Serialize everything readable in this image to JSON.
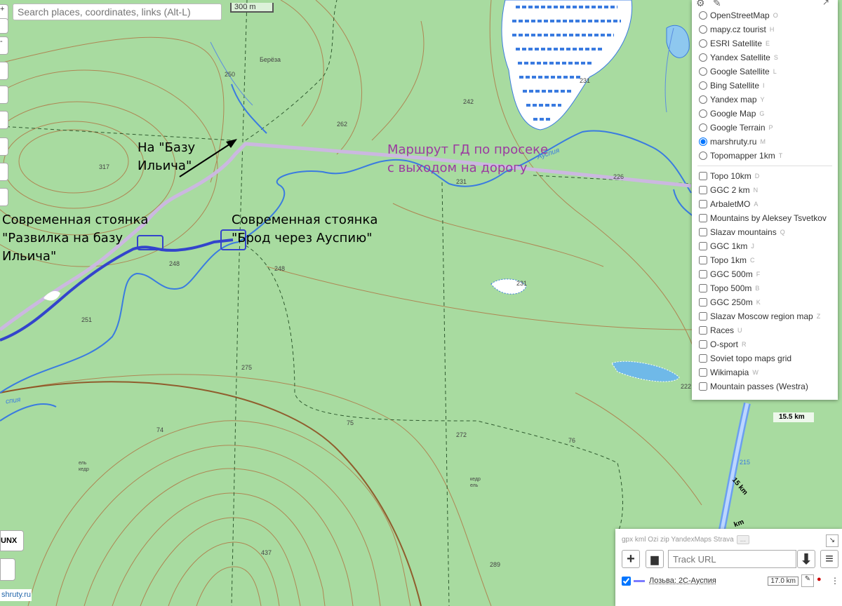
{
  "search": {
    "placeholder": "Search places, coordinates, links (Alt-L)"
  },
  "scale": {
    "label": "300 m"
  },
  "left_toolbar": {
    "unx_label": "UNX",
    "domain_label": "shruty.ru"
  },
  "annotations": {
    "to_base": "На \"Базу\nИльича\"",
    "camp_fork": "Современная стоянка\n\"Развилка на базу\nИльича\"",
    "camp_ford": "Современная стоянка\n\"Брод через Ауспию\"",
    "route": "Маршрут ГД по просеке\nс выходом на дорогу"
  },
  "map_labels": {
    "elev_317": "317",
    "elev_262": "262",
    "elev_242": "242",
    "elev_231a": "231",
    "elev_231b": "231",
    "elev_231c": "231",
    "elev_226": "226",
    "elev_250": "250",
    "elev_248a": "248",
    "elev_248b": "248",
    "elev_251": "251",
    "elev_275": "275",
    "elev_272": "272",
    "elev_289": "289",
    "elev_437": "437",
    "elev_74": "74",
    "elev_75": "75",
    "elev_76": "76",
    "elev_222": "222",
    "elev_215": "215",
    "river_auspiya": "Ауспия",
    "river_pia": "спия",
    "birch": "Берёза",
    "spruce_cedar": "ель\nкедр",
    "cedar_spruce": "кедр\nель",
    "km_15_5": "15.5 km",
    "km_15": "15 km",
    "km_14": "km"
  },
  "colors": {
    "map_green": "#a8dba0",
    "track_blue": "#3344cc",
    "route_purple": "#cbb8e0",
    "annotation_purple": "#9b3aa0",
    "river_blue": "#3a7be0",
    "contour_brown": "#a0522d"
  },
  "layers": {
    "base": [
      {
        "label": "OpenStreetMap",
        "key": "O",
        "checked": false
      },
      {
        "label": "mapy.cz tourist",
        "key": "H",
        "checked": false
      },
      {
        "label": "ESRI Satellite",
        "key": "E",
        "checked": false
      },
      {
        "label": "Yandex Satellite",
        "key": "S",
        "checked": false
      },
      {
        "label": "Google Satellite",
        "key": "L",
        "checked": false
      },
      {
        "label": "Bing Satellite",
        "key": "I",
        "checked": false
      },
      {
        "label": "Yandex map",
        "key": "Y",
        "checked": false
      },
      {
        "label": "Google Map",
        "key": "G",
        "checked": false
      },
      {
        "label": "Google Terrain",
        "key": "P",
        "checked": false
      },
      {
        "label": "marshruty.ru",
        "key": "M",
        "checked": true
      },
      {
        "label": "Topomapper 1km",
        "key": "T",
        "checked": false
      }
    ],
    "overlays": [
      {
        "label": "Topo 10km",
        "key": "D",
        "checked": false
      },
      {
        "label": "GGC 2 km",
        "key": "N",
        "checked": false
      },
      {
        "label": "ArbaletMO",
        "key": "A",
        "checked": false
      },
      {
        "label": "Mountains by Aleksey Tsvetkov",
        "key": "",
        "checked": false
      },
      {
        "label": "Slazav mountains",
        "key": "Q",
        "checked": false
      },
      {
        "label": "GGC 1km",
        "key": "J",
        "checked": false
      },
      {
        "label": "Topo 1km",
        "key": "C",
        "checked": false
      },
      {
        "label": "GGC 500m",
        "key": "F",
        "checked": false
      },
      {
        "label": "Topo 500m",
        "key": "B",
        "checked": false
      },
      {
        "label": "GGC 250m",
        "key": "K",
        "checked": false
      },
      {
        "label": "Slazav Moscow region map",
        "key": "Z",
        "checked": false
      },
      {
        "label": "Races",
        "key": "U",
        "checked": false
      },
      {
        "label": "O-sport",
        "key": "R",
        "checked": false
      },
      {
        "label": "Soviet topo maps grid",
        "key": "",
        "checked": false
      },
      {
        "label": "Wikimapia",
        "key": "W",
        "checked": false
      },
      {
        "label": "Mountain passes (Westra)",
        "key": "",
        "checked": false
      }
    ]
  },
  "tracks": {
    "formats": "gpx kml Ozi zip YandexMaps Strava",
    "formats_more": "...",
    "url_placeholder": "Track URL",
    "track_name": "Лозьва: 2С-Ауспия",
    "track_length": "17.0 km"
  }
}
